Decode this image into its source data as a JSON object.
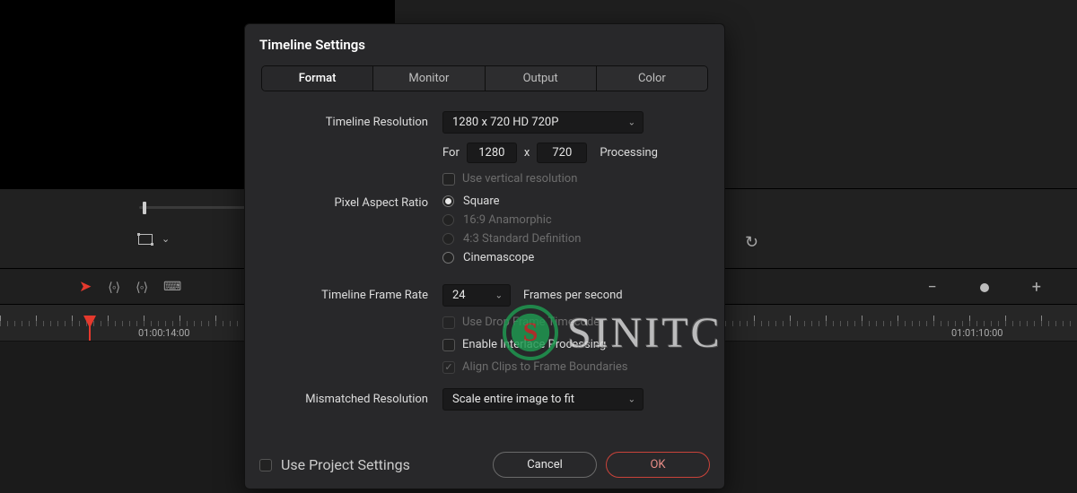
{
  "dialog": {
    "title": "Timeline Settings",
    "tabs": [
      "Format",
      "Monitor",
      "Output",
      "Color"
    ],
    "active_tab": 0,
    "resolution": {
      "label": "Timeline Resolution",
      "preset": "1280 x 720 HD 720P",
      "for_label": "For",
      "width": "1280",
      "x_label": "x",
      "height": "720",
      "processing_label": "Processing",
      "use_vertical_label": "Use vertical resolution",
      "use_vertical_checked": false
    },
    "par": {
      "label": "Pixel Aspect Ratio",
      "options": [
        "Square",
        "16:9 Anamorphic",
        "4:3 Standard Definition",
        "Cinemascope"
      ],
      "selected": 0,
      "disabled": [
        1,
        2
      ]
    },
    "frame_rate": {
      "label": "Timeline Frame Rate",
      "value": "24",
      "suffix": "Frames per second",
      "drop_frame_label": "Use Drop Frame Timecode",
      "drop_frame_checked": false,
      "drop_frame_disabled": true,
      "interlace_label": "Enable Interlace Processing",
      "interlace_checked": false,
      "align_label": "Align Clips to Frame Boundaries",
      "align_checked": true,
      "align_disabled": true
    },
    "mismatch": {
      "label": "Mismatched Resolution",
      "value": "Scale entire image to fit"
    },
    "use_project_label": "Use Project Settings",
    "use_project_checked": false,
    "cancel_label": "Cancel",
    "ok_label": "OK"
  },
  "timeline": {
    "tc_left": "01:00:14:00",
    "tc_right": "01:01:10:00"
  },
  "zoom": {
    "minus": "−",
    "plus": "+"
  },
  "watermark": "SINITC"
}
